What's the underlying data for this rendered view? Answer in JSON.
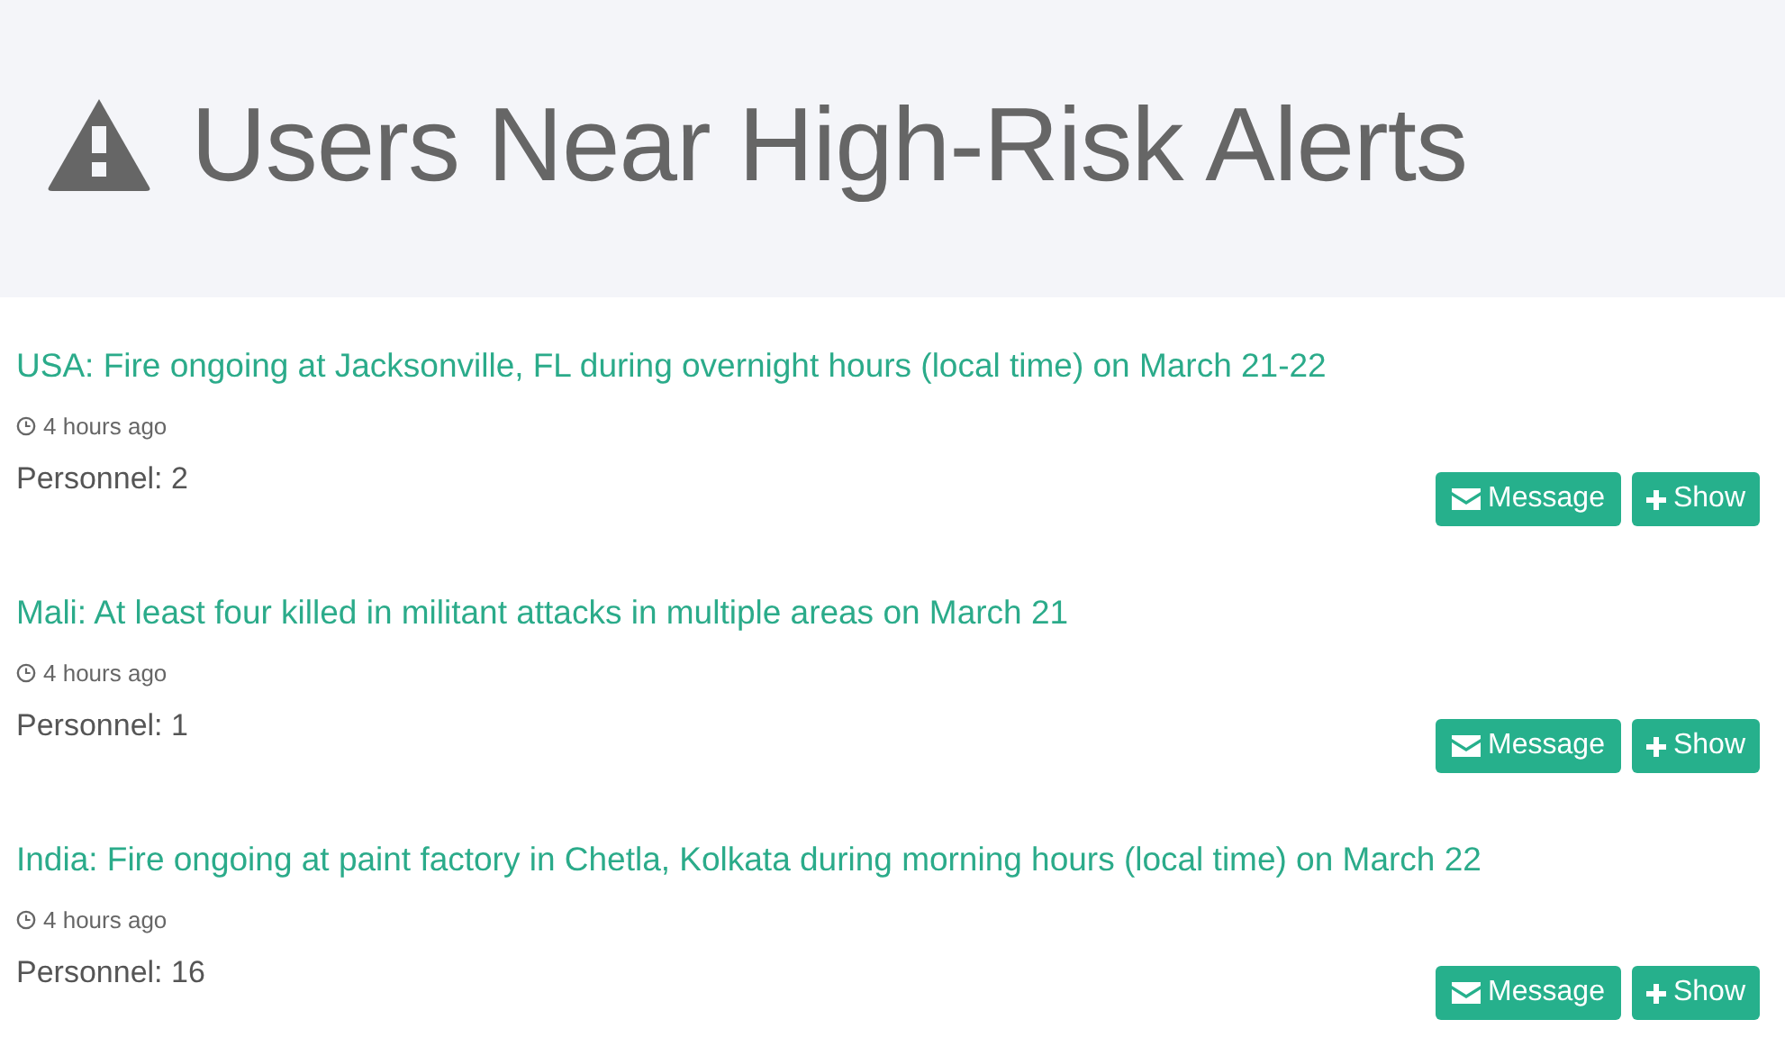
{
  "header": {
    "title": "Users Near High-Risk Alerts"
  },
  "alerts": [
    {
      "title": "USA: Fire ongoing at Jacksonville, FL during overnight hours (local time) on March 21-22",
      "time": "4 hours ago",
      "personnel": "Personnel: 2",
      "message_button": "Message",
      "show_button": "Show"
    },
    {
      "title": "Mali: At least four killed in militant attacks in multiple areas on March 21",
      "time": "4 hours ago",
      "personnel": "Personnel: 1",
      "message_button": "Message",
      "show_button": "Show"
    },
    {
      "title": "India: Fire ongoing at paint factory in Chetla, Kolkata during morning hours (local time) on March 22",
      "time": "4 hours ago",
      "personnel": "Personnel: 16",
      "message_button": "Message",
      "show_button": "Show"
    }
  ]
}
